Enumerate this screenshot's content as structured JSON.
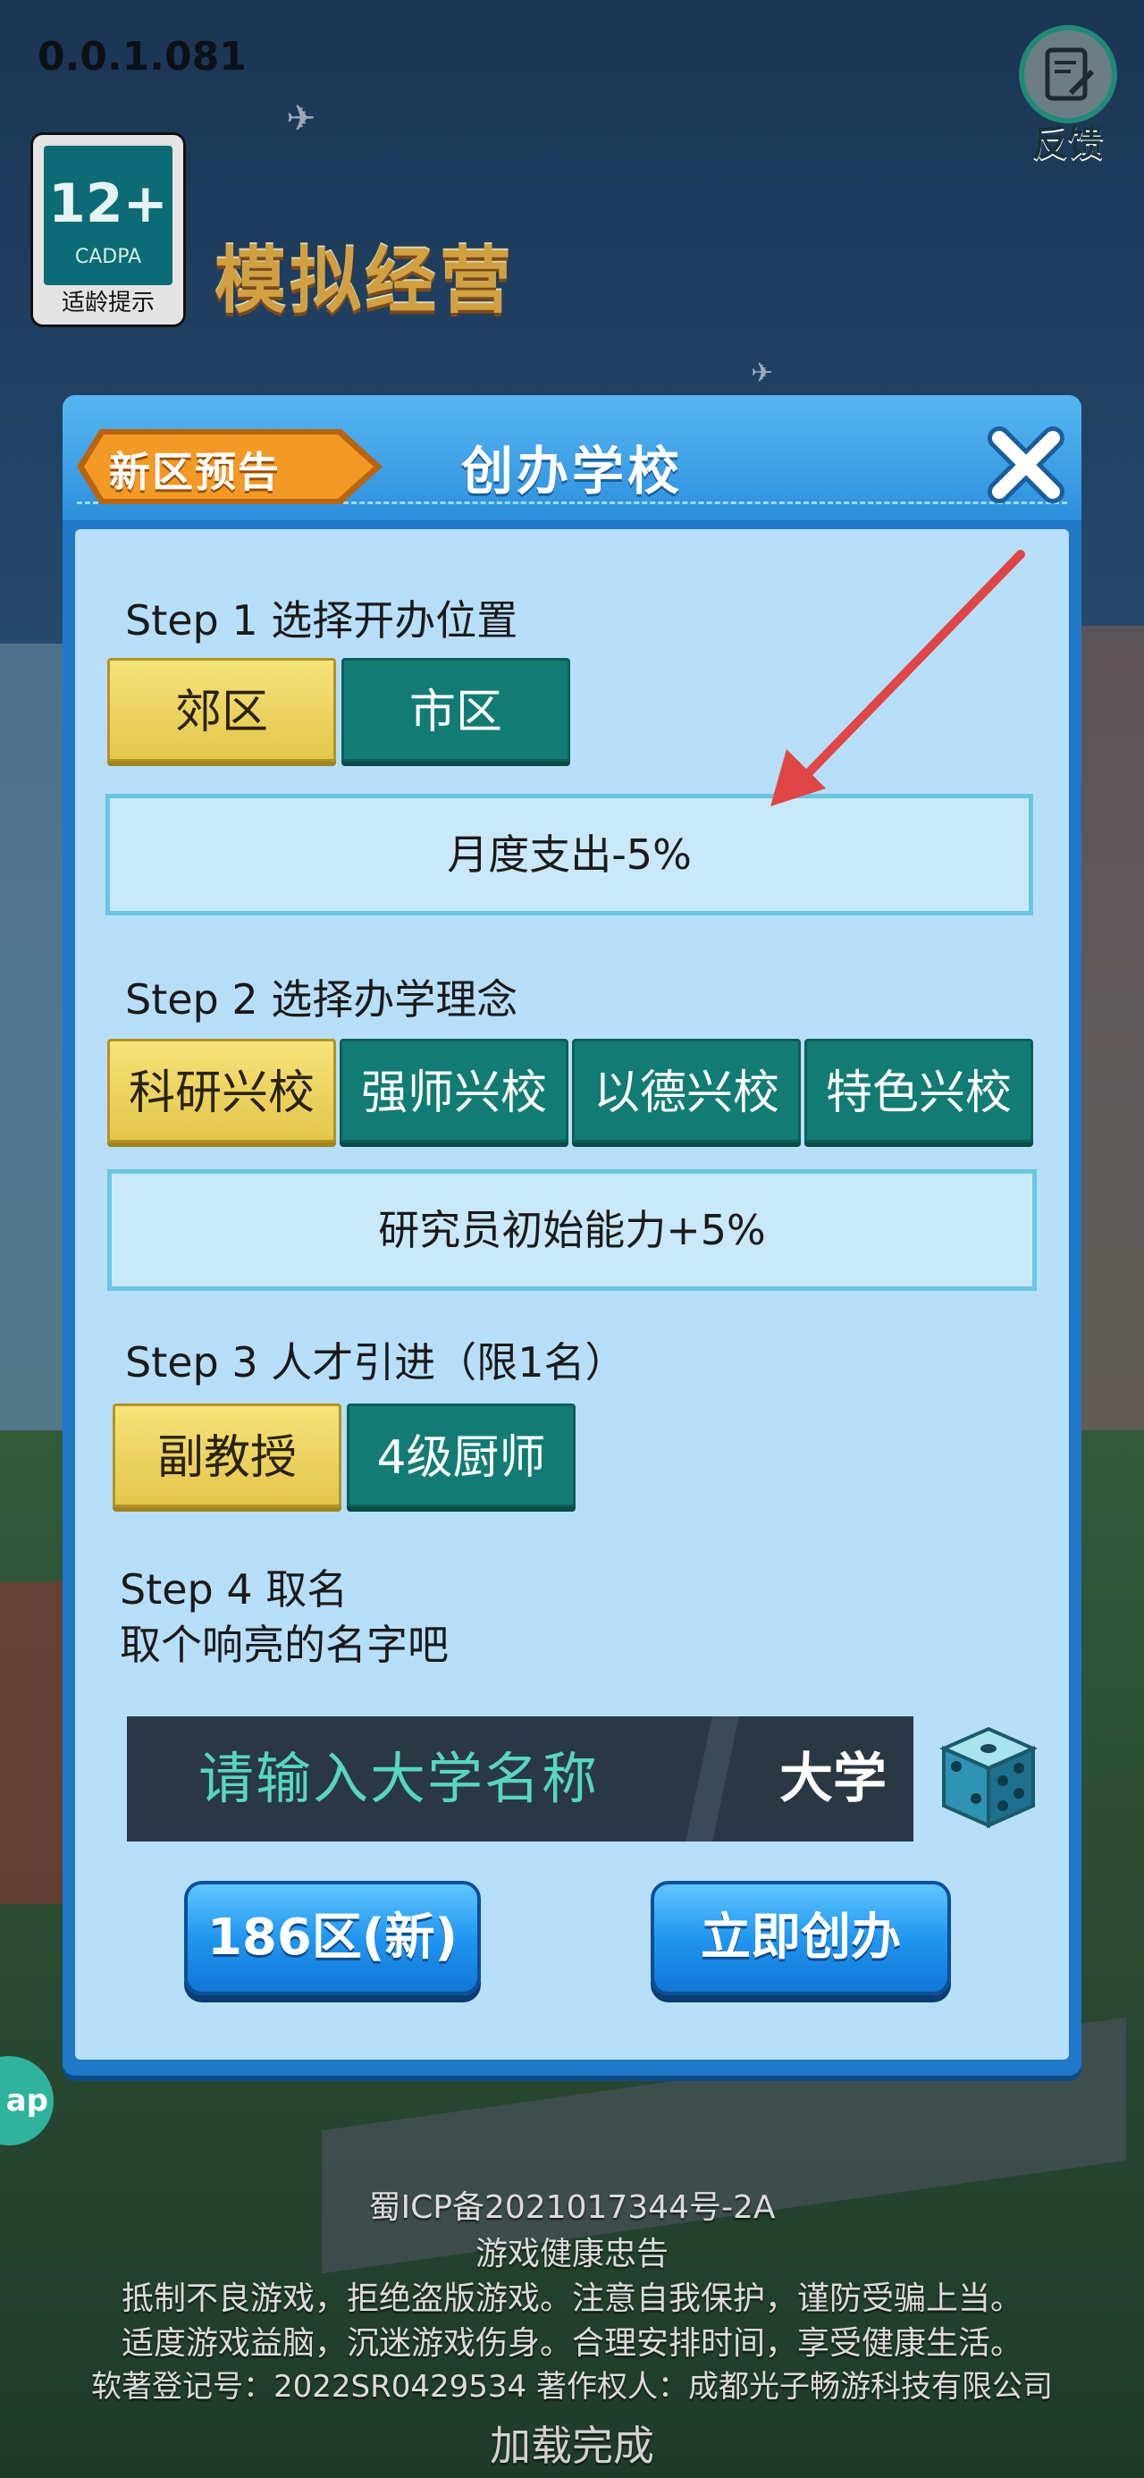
{
  "version": "0.0.1.081",
  "age_rating": {
    "number": "12+",
    "org": "CADPA",
    "tip": "适龄提示"
  },
  "game_logo": "模拟经营",
  "feedback_label": "反馈",
  "side_app_label": "ap",
  "dialog": {
    "title": "创办学校",
    "new_zone_tag": "新区预告",
    "step1": {
      "label": "Step 1 选择开办位置",
      "options": [
        "郊区",
        "市区"
      ],
      "selected": "郊区",
      "info": "月度支出-5%"
    },
    "step2": {
      "label": "Step 2 选择办学理念",
      "options": [
        "科研兴校",
        "强师兴校",
        "以德兴校",
        "特色兴校"
      ],
      "selected": "科研兴校",
      "info": "研究员初始能力+5%"
    },
    "step3": {
      "label": "Step 3 人才引进（限1名）",
      "options": [
        "副教授",
        "4级厨师"
      ],
      "selected": "副教授"
    },
    "step4": {
      "label": "Step 4 取名",
      "hint": "取个响亮的名字吧",
      "placeholder": "请输入大学名称",
      "suffix": "大学"
    },
    "server_button": "186区(新)",
    "create_button": "立即创办"
  },
  "footer": {
    "icp": "蜀ICP备2021017344号-2A",
    "health_title": "游戏健康忠告",
    "health_line1": "抵制不良游戏，拒绝盗版游戏。注意自我保护，谨防受骗上当。",
    "health_line2": "适度游戏益脑，沉迷游戏伤身。合理安排时间，享受健康生活。",
    "copyright": "软著登记号：2022SR0429534  著作权人：成都光子畅游科技有限公司",
    "loading": "加载完成"
  },
  "colors": {
    "selected": "#e9cf5a",
    "unselected": "#127c74",
    "panel": "#b8dffa",
    "frame": "#1f78c8",
    "annotation_arrow": "#e04646"
  }
}
